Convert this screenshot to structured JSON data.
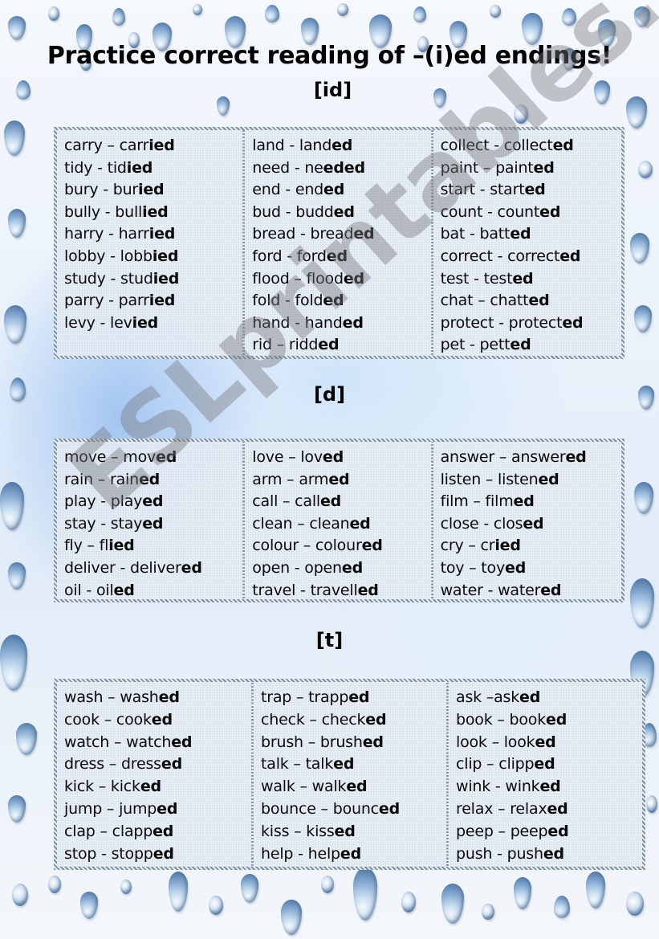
{
  "title": "Practice correct reading of –(i)ed endings!",
  "watermark": "ESLprintables.com",
  "colors": {
    "text": "#000000",
    "table_bg": "#e4ecf4",
    "border": "#7d8fa3",
    "drop_blue": "#4d7cb3"
  },
  "sections": [
    {
      "label": "[id]",
      "columns": [
        [
          {
            "base": "carry",
            "sep": " – ",
            "stem": "carr",
            "ending": "ied"
          },
          {
            "base": "tidy",
            "sep": " - ",
            "stem": "tid",
            "ending": "ied"
          },
          {
            "base": "bury",
            "sep": " - ",
            "stem": "bur",
            "ending": "ied"
          },
          {
            "base": "bully",
            "sep": " - ",
            "stem": "bull",
            "ending": "ied"
          },
          {
            "base": "harry",
            "sep": " - ",
            "stem": "harr",
            "ending": "ied"
          },
          {
            "base": "lobby",
            "sep": " - ",
            "stem": "lobb",
            "ending": "ied"
          },
          {
            "base": "study",
            "sep": " - ",
            "stem": "stud",
            "ending": "ied"
          },
          {
            "base": "parry",
            "sep": " - ",
            "stem": "parr",
            "ending": "ied"
          },
          {
            "base": "levy",
            "sep": " - ",
            "stem": "lev",
            "ending": "ied"
          }
        ],
        [
          {
            "base": "land",
            "sep": " - ",
            "stem": "land",
            "ending": "ed"
          },
          {
            "base": "need",
            "sep": " - ",
            "stem": "ne",
            "ending": "eded"
          },
          {
            "base": "end",
            "sep": " - ",
            "stem": "end",
            "ending": "ed"
          },
          {
            "base": "bud",
            "sep": " - ",
            "stem": "budd",
            "ending": "ed"
          },
          {
            "base": "bread",
            "sep": " - ",
            "stem": "bread",
            "ending": "ed"
          },
          {
            "base": "ford",
            "sep": " - ",
            "stem": "ford",
            "ending": "ed"
          },
          {
            "base": "flood",
            "sep": " – ",
            "stem": "flood",
            "ending": "ed"
          },
          {
            "base": "fold",
            "sep": " - ",
            "stem": "fold",
            "ending": "ed"
          },
          {
            "base": "hand",
            "sep": " - ",
            "stem": "hand",
            "ending": "ed"
          },
          {
            "base": "rid",
            "sep": " – ",
            "stem": "ridd",
            "ending": "ed"
          }
        ],
        [
          {
            "base": "collect",
            "sep": " - ",
            "stem": "collect",
            "ending": "ed"
          },
          {
            "base": "paint",
            "sep": " – ",
            "stem": "paint",
            "ending": "ed"
          },
          {
            "base": "start",
            "sep": " - ",
            "stem": "start",
            "ending": "ed"
          },
          {
            "base": "count",
            "sep": " - ",
            "stem": "count",
            "ending": "ed"
          },
          {
            "base": "bat",
            "sep": " - ",
            "stem": "batt",
            "ending": "ed"
          },
          {
            "base": "correct",
            "sep": " - ",
            "stem": "correct",
            "ending": "ed"
          },
          {
            "base": "test",
            "sep": " - ",
            "stem": "test",
            "ending": "ed"
          },
          {
            "base": "chat",
            "sep": " – ",
            "stem": "chatt",
            "ending": "ed"
          },
          {
            "base": "protect",
            "sep": " - ",
            "stem": "protect",
            "ending": "ed"
          },
          {
            "base": "pet",
            "sep": " - ",
            "stem": "pett",
            "ending": "ed"
          }
        ]
      ]
    },
    {
      "label": "[d]",
      "columns": [
        [
          {
            "base": "move",
            "sep": " – ",
            "stem": "mov",
            "ending": "ed"
          },
          {
            "base": "rain",
            "sep": " – ",
            "stem": "rain",
            "ending": "ed"
          },
          {
            "base": "play",
            "sep": " - ",
            "stem": "play",
            "ending": "ed"
          },
          {
            "base": "stay",
            "sep": " - ",
            "stem": "stay",
            "ending": "ed"
          },
          {
            "base": "fly",
            "sep": " – ",
            "stem": "fl",
            "ending": "ied"
          },
          {
            "base": "deliver",
            "sep": " - ",
            "stem": "deliver",
            "ending": "ed"
          },
          {
            "base": "oil",
            "sep": " - ",
            "stem": "oil",
            "ending": "ed"
          }
        ],
        [
          {
            "base": "love",
            "sep": " – ",
            "stem": "lov",
            "ending": "ed"
          },
          {
            "base": "arm",
            "sep": " – ",
            "stem": "arm",
            "ending": "ed"
          },
          {
            "base": "call",
            "sep": " – ",
            "stem": "call",
            "ending": "ed"
          },
          {
            "base": "clean",
            "sep": " – ",
            "stem": "clean",
            "ending": "ed"
          },
          {
            "base": "colour",
            "sep": " – ",
            "stem": "colour",
            "ending": "ed"
          },
          {
            "base": "open",
            "sep": " - ",
            "stem": "open",
            "ending": "ed"
          },
          {
            "base": "travel",
            "sep": " - ",
            "stem": "travell",
            "ending": "ed"
          }
        ],
        [
          {
            "base": "answer",
            "sep": " – ",
            "stem": "answer",
            "ending": "ed"
          },
          {
            "base": "listen",
            "sep": " – ",
            "stem": "listen",
            "ending": "ed"
          },
          {
            "base": "film",
            "sep": " – ",
            "stem": "film",
            "ending": "ed"
          },
          {
            "base": "close",
            "sep": " - ",
            "stem": "clos",
            "ending": "ed"
          },
          {
            "base": "cry",
            "sep": " – ",
            "stem": "cr",
            "ending": "ied"
          },
          {
            "base": "toy",
            "sep": " – ",
            "stem": "toy",
            "ending": "ed"
          },
          {
            "base": "water",
            "sep": " - ",
            "stem": "water",
            "ending": "ed"
          }
        ]
      ]
    },
    {
      "label": "[t]",
      "columns": [
        [
          {
            "base": "wash",
            "sep": " – ",
            "stem": "wash",
            "ending": "ed"
          },
          {
            "base": "cook",
            "sep": " – ",
            "stem": "cook",
            "ending": "ed"
          },
          {
            "base": "watch",
            "sep": " – ",
            "stem": "watch",
            "ending": "ed"
          },
          {
            "base": "dress",
            "sep": " – ",
            "stem": "dress",
            "ending": "ed"
          },
          {
            "base": "kick",
            "sep": " – ",
            "stem": "kick",
            "ending": "ed"
          },
          {
            "base": "jump",
            "sep": " – ",
            "stem": "jump",
            "ending": "ed"
          },
          {
            "base": "clap",
            "sep": " – ",
            "stem": "clapp",
            "ending": "ed"
          },
          {
            "base": "stop",
            "sep": " - ",
            "stem": "stopp",
            "ending": "ed"
          }
        ],
        [
          {
            "base": "trap",
            "sep": " – ",
            "stem": "trapp",
            "ending": "ed"
          },
          {
            "base": "check",
            "sep": " – ",
            "stem": "check",
            "ending": "ed"
          },
          {
            "base": "brush",
            "sep": " – ",
            "stem": "brush",
            "ending": "ed"
          },
          {
            "base": "talk",
            "sep": " – ",
            "stem": "talk",
            "ending": "ed"
          },
          {
            "base": "walk",
            "sep": " – ",
            "stem": "walk",
            "ending": "ed"
          },
          {
            "base": "bounce",
            "sep": " – ",
            "stem": "bounc",
            "ending": "ed"
          },
          {
            "base": "kiss",
            "sep": " – ",
            "stem": "kiss",
            "ending": "ed"
          },
          {
            "base": "help",
            "sep": " - ",
            "stem": "help",
            "ending": "ed"
          }
        ],
        [
          {
            "base": "ask",
            "sep": " –",
            "stem": "ask",
            "ending": "ed"
          },
          {
            "base": "book",
            "sep": " – ",
            "stem": "book",
            "ending": "ed"
          },
          {
            "base": "look",
            "sep": "  – ",
            "stem": "look",
            "ending": "ed"
          },
          {
            "base": "clip",
            "sep": " – ",
            "stem": "clipp",
            "ending": "ed"
          },
          {
            "base": "wink",
            "sep": " - ",
            "stem": "wink",
            "ending": "ed"
          },
          {
            "base": "relax",
            "sep": " – ",
            "stem": "relax",
            "ending": "ed"
          },
          {
            "base": "peep",
            "sep": " – ",
            "stem": "peep",
            "ending": "ed"
          },
          {
            "base": "push",
            "sep": " - ",
            "stem": "push",
            "ending": "ed"
          }
        ]
      ]
    }
  ]
}
